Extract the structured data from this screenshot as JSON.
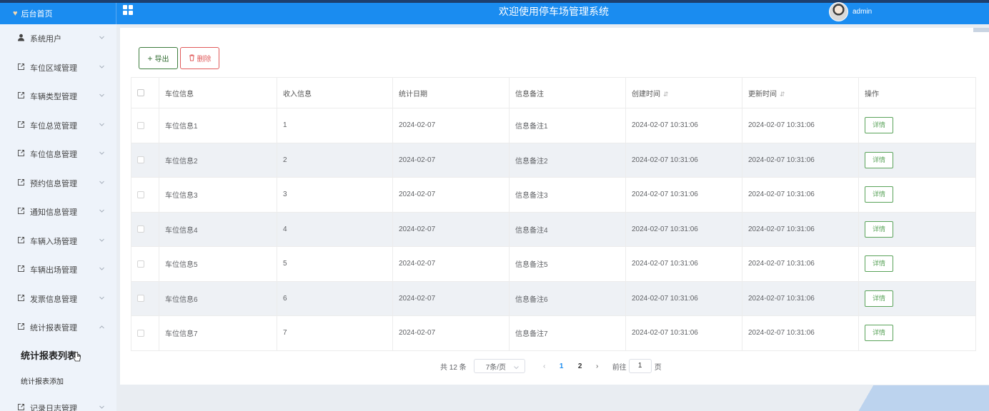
{
  "header": {
    "home_label": "后台首页",
    "title": "欢迎使用停车场管理系统",
    "username": "admin"
  },
  "sidebar": {
    "items": [
      {
        "label": "系统用户",
        "icon": "user-icon"
      },
      {
        "label": "车位区域管理",
        "icon": "external-link-icon"
      },
      {
        "label": "车辆类型管理",
        "icon": "external-link-icon"
      },
      {
        "label": "车位总览管理",
        "icon": "external-link-icon"
      },
      {
        "label": "车位信息管理",
        "icon": "external-link-icon"
      },
      {
        "label": "预约信息管理",
        "icon": "external-link-icon"
      },
      {
        "label": "通知信息管理",
        "icon": "external-link-icon"
      },
      {
        "label": "车辆入场管理",
        "icon": "external-link-icon"
      },
      {
        "label": "车辆出场管理",
        "icon": "external-link-icon"
      },
      {
        "label": "发票信息管理",
        "icon": "external-link-icon"
      },
      {
        "label": "统计报表管理",
        "icon": "external-link-icon",
        "expanded": true
      }
    ],
    "subitems": [
      {
        "label": "统计报表列表",
        "active": true
      },
      {
        "label": "统计报表添加"
      }
    ],
    "last_item": {
      "label": "记录日志管理",
      "icon": "external-link-icon"
    }
  },
  "toolbar": {
    "export_label": "导出",
    "delete_label": "删除"
  },
  "table": {
    "columns": [
      "车位信息",
      "收入信息",
      "统计日期",
      "信息备注",
      "创建时间",
      "更新时间",
      "操作"
    ],
    "rows": [
      {
        "spot": "车位信息1",
        "income": "1",
        "date": "2024-02-07",
        "note": "信息备注1",
        "created": "2024-02-07 10:31:06",
        "updated": "2024-02-07 10:31:06",
        "action": "详情"
      },
      {
        "spot": "车位信息2",
        "income": "2",
        "date": "2024-02-07",
        "note": "信息备注2",
        "created": "2024-02-07 10:31:06",
        "updated": "2024-02-07 10:31:06",
        "action": "详情"
      },
      {
        "spot": "车位信息3",
        "income": "3",
        "date": "2024-02-07",
        "note": "信息备注3",
        "created": "2024-02-07 10:31:06",
        "updated": "2024-02-07 10:31:06",
        "action": "详情"
      },
      {
        "spot": "车位信息4",
        "income": "4",
        "date": "2024-02-07",
        "note": "信息备注4",
        "created": "2024-02-07 10:31:06",
        "updated": "2024-02-07 10:31:06",
        "action": "详情"
      },
      {
        "spot": "车位信息5",
        "income": "5",
        "date": "2024-02-07",
        "note": "信息备注5",
        "created": "2024-02-07 10:31:06",
        "updated": "2024-02-07 10:31:06",
        "action": "详情"
      },
      {
        "spot": "车位信息6",
        "income": "6",
        "date": "2024-02-07",
        "note": "信息备注6",
        "created": "2024-02-07 10:31:06",
        "updated": "2024-02-07 10:31:06",
        "action": "详情"
      },
      {
        "spot": "车位信息7",
        "income": "7",
        "date": "2024-02-07",
        "note": "信息备注7",
        "created": "2024-02-07 10:31:06",
        "updated": "2024-02-07 10:31:06",
        "action": "详情"
      }
    ]
  },
  "pagination": {
    "total": "共 12 条",
    "page_size": "7条/页",
    "pages": [
      "1",
      "2"
    ],
    "current": "1",
    "goto_label": "前往",
    "goto_value": "1",
    "page_suffix": "页"
  },
  "colors": {
    "header_bg": "#1a8cf0",
    "export_border": "#3d7c3d",
    "delete_color": "#e05a5a",
    "detail_color": "#5aa35a",
    "active_page": "#1a8cf0"
  }
}
